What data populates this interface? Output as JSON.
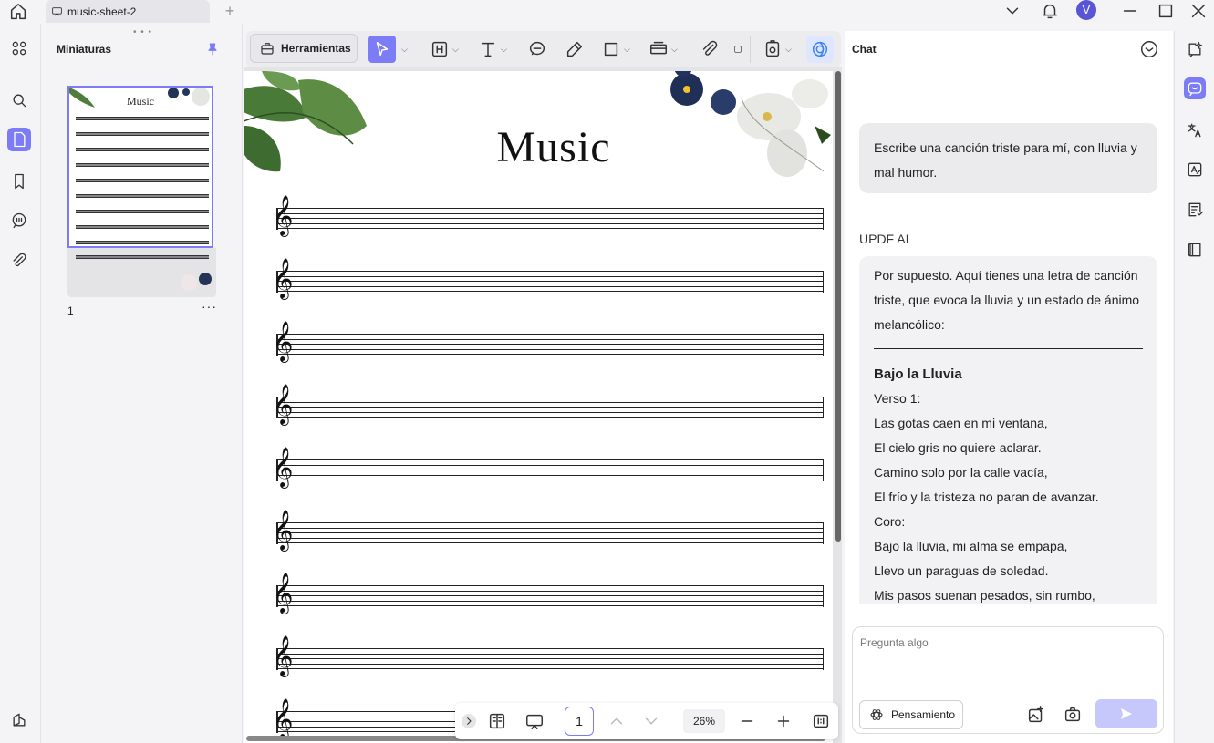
{
  "app": {
    "tab_title": "music-sheet-2",
    "new_tab": "+",
    "avatar_initial": "V",
    "accent_color": "#7b7cf6"
  },
  "thumbnails": {
    "title": "Miniaturas",
    "grip": "• • •",
    "page_number": "1",
    "more": "···",
    "thumb_title": "Music"
  },
  "toolbar": {
    "tools_label": "Herramientas"
  },
  "document": {
    "title": "Music",
    "clef": "𝄞",
    "staff_count": 9
  },
  "page_nav": {
    "page": "1",
    "zoom": "26%"
  },
  "chat": {
    "title": "Chat",
    "user_message": "Escribe una canción triste para mí, con lluvia y mal humor.",
    "ai_label": "UPDF AI",
    "ai_intro": "Por supuesto. Aquí tienes una letra de canción triste, que evoca la lluvia y un estado de ánimo melancólico:",
    "song_title": "Bajo la Lluvia",
    "song_lines": [
      "Verso 1:",
      "Las gotas caen en mi ventana,",
      "El cielo gris no quiere aclarar.",
      "Camino solo por la calle vacía,",
      "El frío y la tristeza no paran de avanzar.",
      "Coro:",
      "Bajo la lluvia, mi alma se empapa,",
      "Llevo un paraguas de soledad.",
      "Mis pasos suenan pesados, sin rumbo,"
    ],
    "input_placeholder": "Pregunta algo",
    "think_label": "Pensamiento"
  }
}
